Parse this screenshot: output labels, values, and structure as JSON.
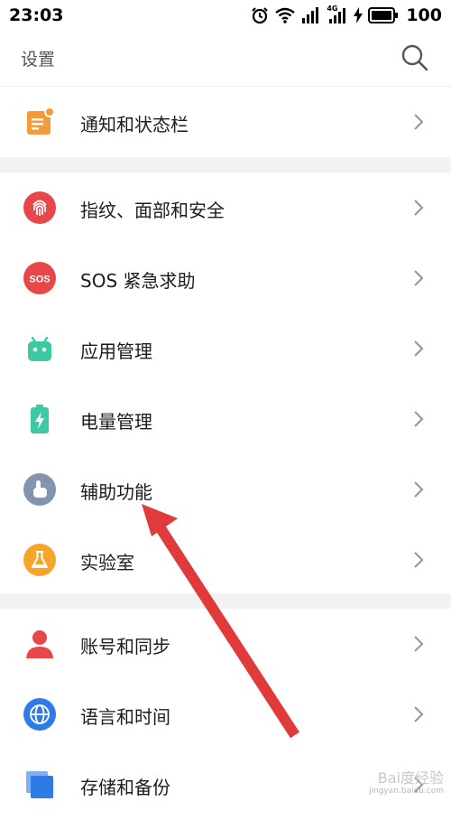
{
  "status_bar": {
    "time": "23:03",
    "network_badge": "4G",
    "battery": "100"
  },
  "header": {
    "title": "设置"
  },
  "sections": [
    {
      "items": [
        {
          "label": "通知和状态栏",
          "icon": "notification-icon",
          "color": "#F39A3A"
        }
      ]
    },
    {
      "items": [
        {
          "label": "指纹、面部和安全",
          "icon": "fingerprint-icon",
          "color": "#E8474A"
        },
        {
          "label": "SOS 紧急求助",
          "icon": "sos-icon",
          "color": "#E8474A",
          "icon_text": "SOS"
        },
        {
          "label": "应用管理",
          "icon": "android-icon",
          "color": "#3CC9A3"
        },
        {
          "label": "电量管理",
          "icon": "battery-icon",
          "color": "#3CC9A3"
        },
        {
          "label": "辅助功能",
          "icon": "hand-pointer-icon",
          "color": "#8394AF"
        },
        {
          "label": "实验室",
          "icon": "flask-icon",
          "color": "#F7A42B"
        }
      ]
    },
    {
      "items": [
        {
          "label": "账号和同步",
          "icon": "user-icon",
          "color": "#E8474A"
        },
        {
          "label": "语言和时间",
          "icon": "globe-icon",
          "color": "#2F7BE6"
        },
        {
          "label": "存储和备份",
          "icon": "storage-icon",
          "color": "#2F7BE6"
        }
      ]
    }
  ],
  "annotation": {
    "arrow_color": "#E03A3A"
  },
  "watermark": {
    "line1": "Bai度经验",
    "line2": "jingyan.baidu.com"
  }
}
